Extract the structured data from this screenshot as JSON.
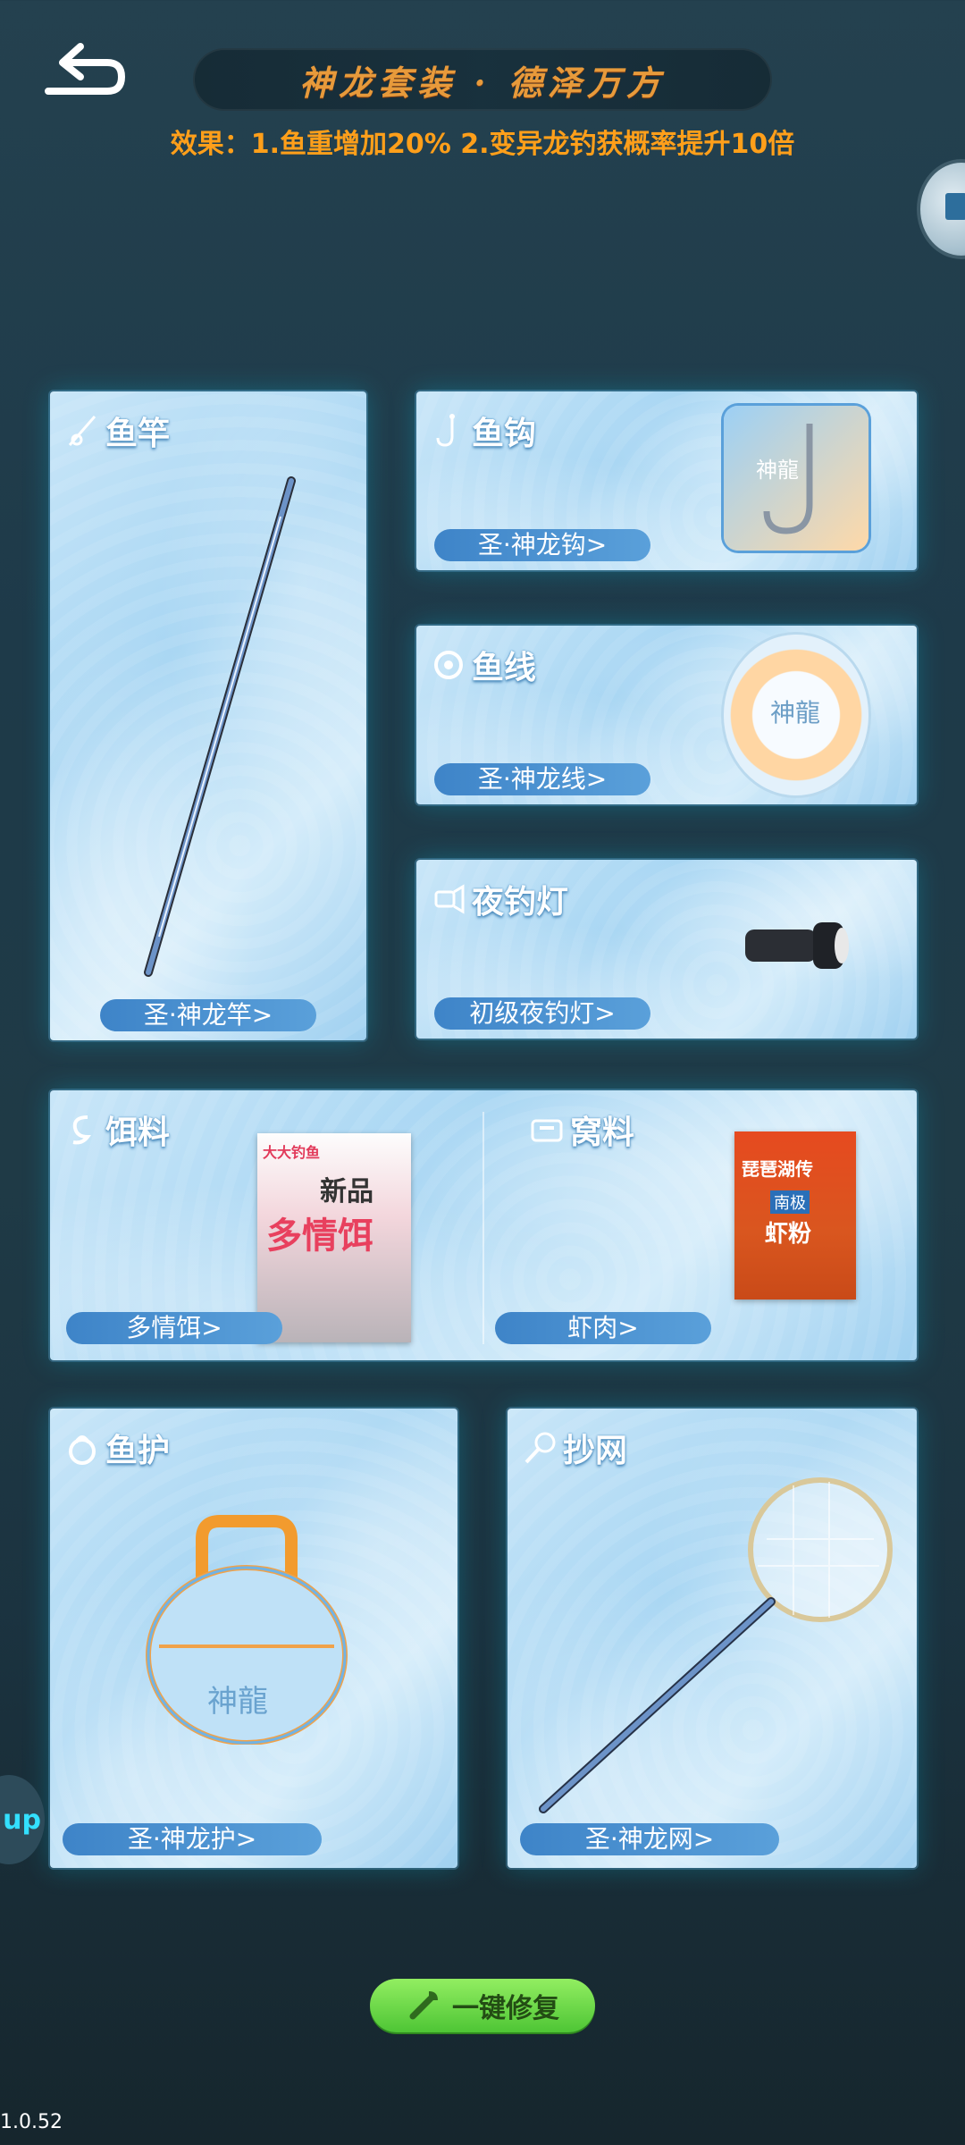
{
  "header": {
    "back_icon": "back-arrow-icon",
    "title": "神龙套装 · 德泽万方",
    "effect": "效果：1.鱼重增加20%  2.变异龙钓获概率提升10倍"
  },
  "side_button_icon": "cube-icon",
  "gear": {
    "rod": {
      "title": "鱼竿",
      "item": "圣·神龙竿>",
      "icon": "rod-icon"
    },
    "hook": {
      "title": "鱼钩",
      "item": "圣·神龙钩>",
      "icon": "hook-icon"
    },
    "line": {
      "title": "鱼线",
      "item": "圣·神龙线>",
      "icon": "line-icon"
    },
    "lamp": {
      "title": "夜钓灯",
      "item": "初级夜钓灯>",
      "icon": "lamp-icon"
    },
    "bait": {
      "title": "饵料",
      "item": "多情饵>",
      "icon": "bait-icon",
      "pack_brand": "大大钓鱼",
      "pack_new": "新品",
      "pack_name": "多情饵"
    },
    "groundbait": {
      "title": "窝料",
      "item": "虾肉>",
      "icon": "groundbait-icon",
      "pack_top": "琵琶湖传",
      "pack_sub": "南极",
      "pack_name": "虾粉"
    },
    "keepnet": {
      "title": "鱼护",
      "item": "圣·神龙护>",
      "icon": "keepnet-icon",
      "bag_text": "神龍"
    },
    "landing_net": {
      "title": "抄网",
      "item": "圣·神龙网>",
      "icon": "net-icon"
    }
  },
  "hook_box_text": "神龍",
  "line_spool_text": "神龍",
  "repair_button": {
    "label": "一键修复",
    "icon": "wrench-icon"
  },
  "up_button": "up",
  "version": "1.0.52"
}
